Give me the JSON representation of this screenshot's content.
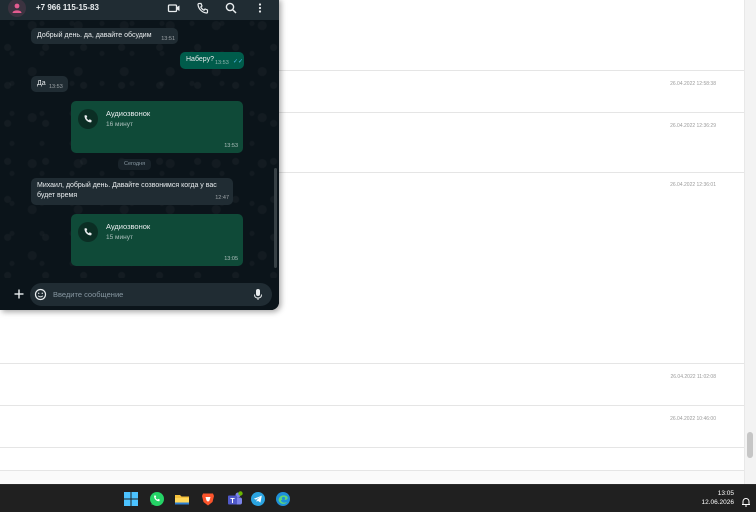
{
  "background": {
    "timestamps": [
      "26.04.2022 12:58:38",
      "26.04.2022 12:36:29",
      "26.04.2022 12:36:01",
      "26.04.2022 11:02:08",
      "26.04.2022 10:46:00"
    ]
  },
  "chat": {
    "contact_phone": "+7 966 115-15-83",
    "icons": [
      "video-call-icon",
      "phone-icon",
      "search-icon",
      "more-icon"
    ],
    "messages": [
      {
        "text": "Добрый день. да, давайте обсудим",
        "time": "13:51",
        "direction": "in"
      },
      {
        "text": "Наберу?",
        "time": "13:53",
        "direction": "out",
        "read": true
      },
      {
        "text": "Да",
        "time": "13:53",
        "direction": "in"
      }
    ],
    "calls": [
      {
        "title": "Аудиозвонок",
        "duration": "16 минут",
        "time": "13:53"
      },
      {
        "title": "Аудиозвонок",
        "duration": "15 минут",
        "time": "13:05"
      }
    ],
    "date_divider": "Сегодня",
    "message_today": {
      "line1": "Михаил, добрый день. Давайте созвонимся когда у вас",
      "line2": "будет время",
      "time": "12:47"
    },
    "input_placeholder": "Введите сообщение"
  },
  "taskbar": {
    "apps": [
      "windows-start",
      "whatsapp",
      "file-explorer",
      "brave-browser",
      "teams",
      "telegram",
      "edge-browser"
    ],
    "time": "13:05",
    "date": "12.06.2026"
  },
  "colors": {
    "chat_bg": "#0b141a",
    "header_bg": "#202c33",
    "outgoing_bubble": "#005c4b",
    "incoming_bubble": "#202c33",
    "call_bubble": "#0f4a38",
    "taskbar_bg": "#202020"
  }
}
